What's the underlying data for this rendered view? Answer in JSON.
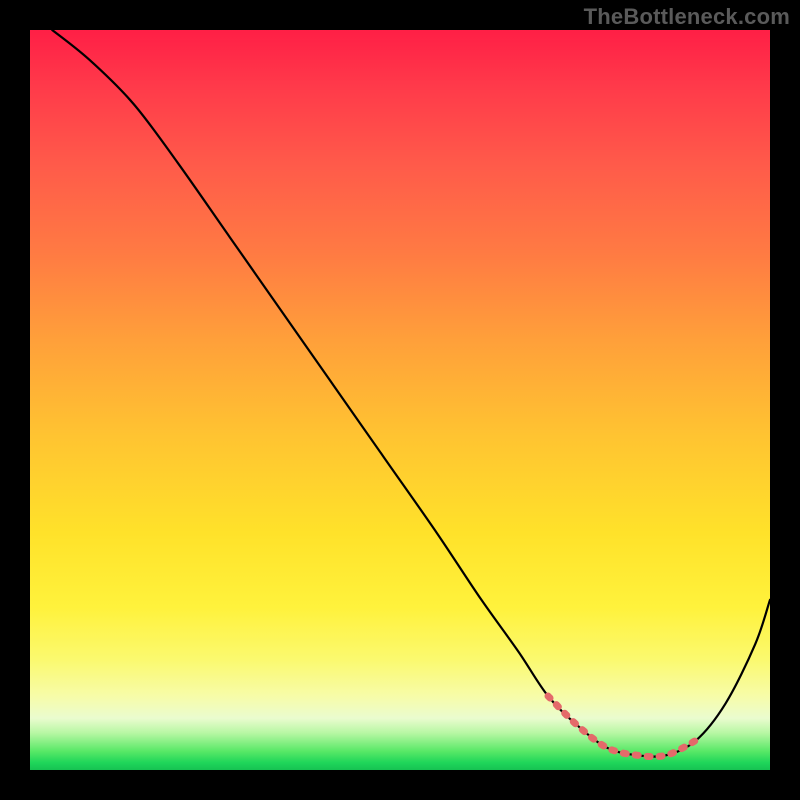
{
  "watermark": "TheBottleneck.com",
  "colors": {
    "frame_bg": "#000000",
    "gradient_top": "#ff1f46",
    "gradient_bottom": "#16c252",
    "curve": "#000000",
    "highlight_segment": "#e46a6a"
  },
  "chart_data": {
    "type": "line",
    "title": "",
    "xlabel": "",
    "ylabel": "",
    "xlim": [
      0,
      100
    ],
    "ylim": [
      0,
      100
    ],
    "grid": false,
    "legend": false,
    "note": "Axes are normalized 0–100; no tick labels rendered. Values estimated from pixel positions.",
    "series": [
      {
        "name": "main-curve",
        "color": "#000000",
        "x": [
          3,
          8,
          14,
          20,
          27,
          34,
          41,
          48,
          55,
          61,
          66,
          70,
          74,
          78,
          82,
          86,
          90,
          94,
          98,
          100
        ],
        "y": [
          100,
          96,
          90,
          82,
          72,
          62,
          52,
          42,
          32,
          23,
          16,
          10,
          6,
          3,
          2,
          2,
          4,
          9,
          17,
          23
        ]
      },
      {
        "name": "optimal-zone",
        "color": "#e46a6a",
        "style": "dotted",
        "x": [
          70,
          74,
          78,
          82,
          86,
          90
        ],
        "y": [
          10,
          6,
          3,
          2,
          2,
          4
        ]
      }
    ]
  }
}
